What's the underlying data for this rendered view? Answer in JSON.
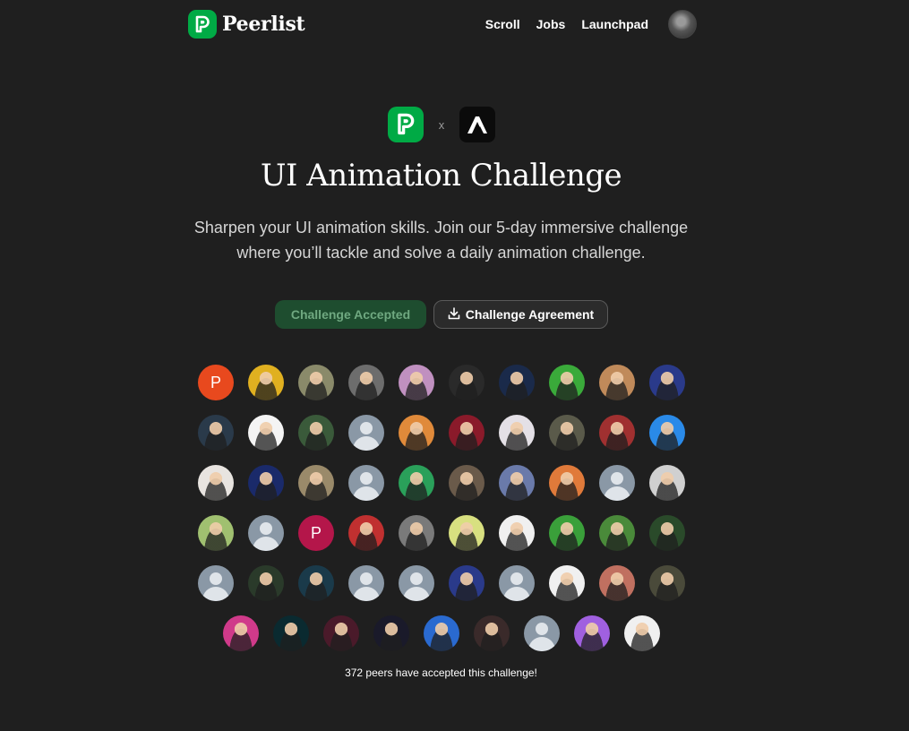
{
  "header": {
    "brand": "Peerlist",
    "nav": [
      "Scroll",
      "Jobs",
      "Launchpad"
    ]
  },
  "partner": {
    "times": "x"
  },
  "hero": {
    "title": "UI Animation Challenge",
    "subtitle": "Sharpen your UI animation skills. Join our 5-day immersive challenge where you’ll tackle and solve a daily animation challenge."
  },
  "actions": {
    "accepted_label": "Challenge Accepted",
    "agreement_label": "Challenge Agreement"
  },
  "participants": {
    "rows": [
      [
        {
          "kind": "letter",
          "text": "P",
          "color": "#e8491e"
        },
        {
          "kind": "photo",
          "color": "#e0b020"
        },
        {
          "kind": "photo",
          "color": "#8a8a6a"
        },
        {
          "kind": "photo",
          "color": "#6d6d6d"
        },
        {
          "kind": "photo",
          "color": "#c090c0"
        },
        {
          "kind": "photo",
          "color": "#2a2a2a"
        },
        {
          "kind": "photo",
          "color": "#1a2a4a"
        },
        {
          "kind": "photo",
          "color": "#3aaa3a"
        },
        {
          "kind": "photo",
          "color": "#c08a5a"
        },
        {
          "kind": "photo",
          "color": "#2a3a8a"
        }
      ],
      [
        {
          "kind": "photo",
          "color": "#2a3a4a"
        },
        {
          "kind": "photo",
          "color": "#f4f4f4"
        },
        {
          "kind": "photo",
          "color": "#3a5a3a"
        },
        {
          "kind": "default"
        },
        {
          "kind": "photo",
          "color": "#e08a3a"
        },
        {
          "kind": "photo",
          "color": "#8a1a2a"
        },
        {
          "kind": "photo",
          "color": "#e4e0e6"
        },
        {
          "kind": "photo",
          "color": "#5a5a4a"
        },
        {
          "kind": "photo",
          "color": "#a03030"
        },
        {
          "kind": "photo",
          "color": "#2a8ae8"
        }
      ],
      [
        {
          "kind": "photo",
          "color": "#e8e4e0"
        },
        {
          "kind": "photo",
          "color": "#1a2a6a"
        },
        {
          "kind": "photo",
          "color": "#9a8a6a"
        },
        {
          "kind": "default"
        },
        {
          "kind": "photo",
          "color": "#2aa05a"
        },
        {
          "kind": "photo",
          "color": "#6a5a4a"
        },
        {
          "kind": "photo",
          "color": "#6a7aaa"
        },
        {
          "kind": "photo",
          "color": "#e07a3a"
        },
        {
          "kind": "default"
        },
        {
          "kind": "photo",
          "color": "#d0d0d0"
        }
      ],
      [
        {
          "kind": "photo",
          "color": "#a0c070"
        },
        {
          "kind": "default"
        },
        {
          "kind": "letter",
          "text": "P",
          "color": "#b4164a"
        },
        {
          "kind": "photo",
          "color": "#c03030"
        },
        {
          "kind": "photo",
          "color": "#7a7a7a"
        },
        {
          "kind": "photo",
          "color": "#d8e080"
        },
        {
          "kind": "photo",
          "color": "#f0f0f0"
        },
        {
          "kind": "photo",
          "color": "#3aa03a"
        },
        {
          "kind": "photo",
          "color": "#4a8a3a"
        },
        {
          "kind": "photo",
          "color": "#2a4a2a"
        }
      ],
      [
        {
          "kind": "default"
        },
        {
          "kind": "photo",
          "color": "#2a3a2a"
        },
        {
          "kind": "photo",
          "color": "#1a3a4a"
        },
        {
          "kind": "default"
        },
        {
          "kind": "default"
        },
        {
          "kind": "photo",
          "color": "#2a3a8a"
        },
        {
          "kind": "default"
        },
        {
          "kind": "photo",
          "color": "#f0f0f0"
        },
        {
          "kind": "photo",
          "color": "#c07060"
        },
        {
          "kind": "photo",
          "color": "#4a4a3a"
        }
      ],
      [
        {
          "kind": "photo",
          "color": "#d03a8a"
        },
        {
          "kind": "photo",
          "color": "#0a2a30"
        },
        {
          "kind": "photo",
          "color": "#4a1a2a"
        },
        {
          "kind": "photo",
          "color": "#1a1a2a"
        },
        {
          "kind": "photo",
          "color": "#2a6ad0"
        },
        {
          "kind": "photo",
          "color": "#3a2a2a"
        },
        {
          "kind": "default"
        },
        {
          "kind": "photo",
          "color": "#a060e0"
        },
        {
          "kind": "photo",
          "color": "#f0f0f0"
        }
      ]
    ],
    "count_text": "372 peers have accepted this challenge!"
  }
}
